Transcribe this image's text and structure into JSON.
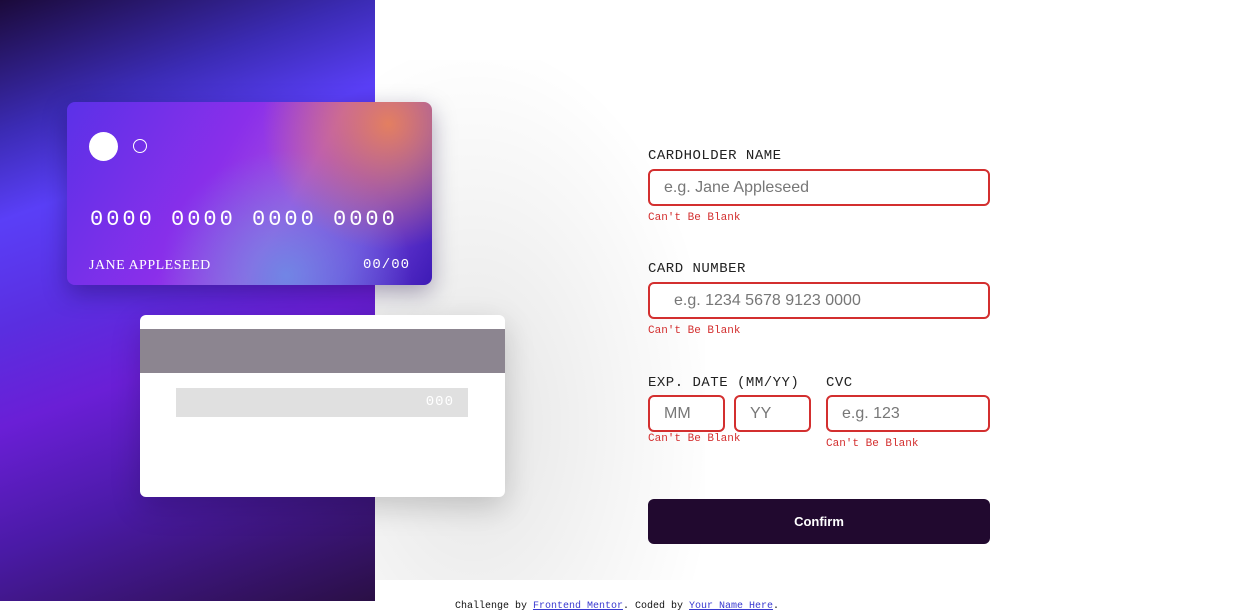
{
  "card_front": {
    "number": "0000 0000 0000 0000",
    "name": "JANE APPLESEED",
    "expiry": "00/00"
  },
  "card_back": {
    "cvc": "000"
  },
  "form": {
    "cardholder_label": "CARDHOLDER NAME",
    "cardholder_placeholder": "e.g. Jane Appleseed",
    "cardholder_error": "Can't Be Blank",
    "number_label": "CARD NUMBER",
    "number_placeholder": "e.g. 1234 5678 9123 0000",
    "number_error": "Can't Be Blank",
    "expiry_label": "EXP. DATE (MM/YY)",
    "mm_placeholder": "MM",
    "yy_placeholder": "YY",
    "expiry_error": "Can't Be Blank",
    "cvc_label": "CVC",
    "cvc_placeholder": "e.g. 123",
    "cvc_error": "Can't Be Blank",
    "confirm_label": "Confirm"
  },
  "attribution": {
    "prefix": "Challenge by ",
    "link1": "Frontend Mentor",
    "middle": ". Coded by ",
    "link2": "Your Name Here",
    "suffix": "."
  },
  "colors": {
    "error": "#d32f2f",
    "button": "#21092f",
    "accent_purple": "#5a3ff7"
  }
}
